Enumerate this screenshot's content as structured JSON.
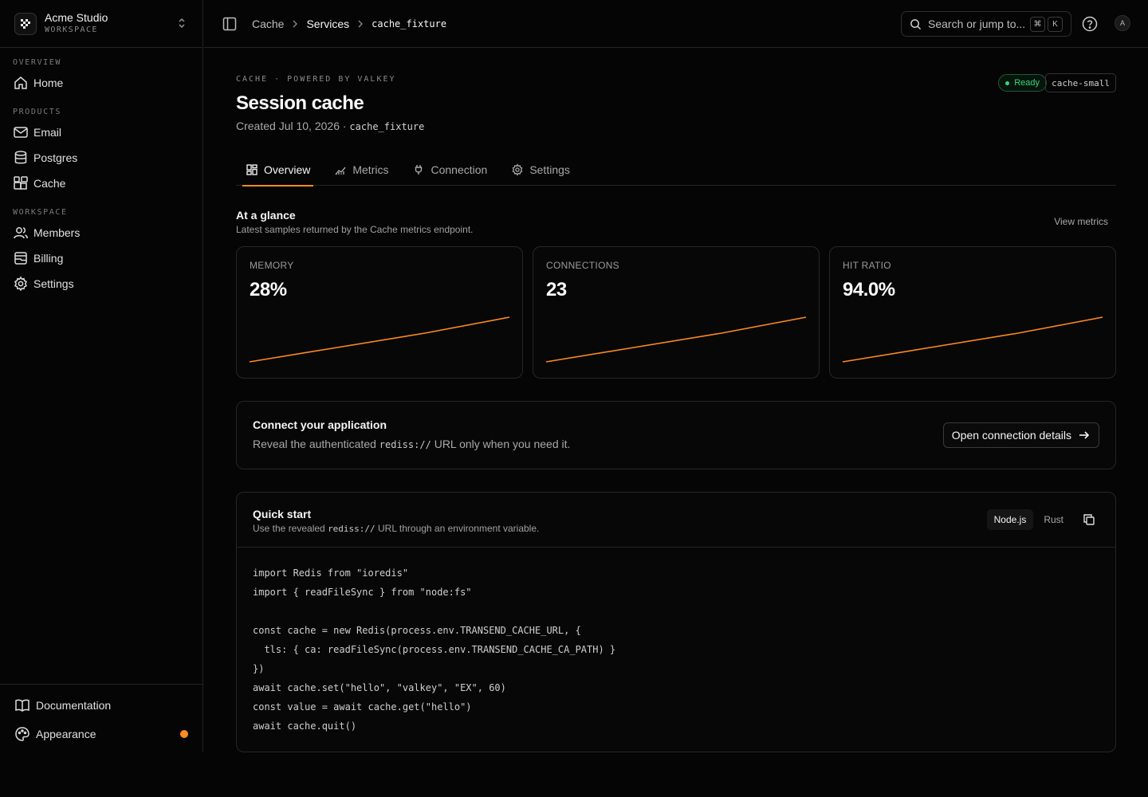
{
  "workspace": {
    "name": "Acme Studio",
    "type": "WORKSPACE"
  },
  "sidebar": {
    "sections": [
      {
        "heading": "OVERVIEW",
        "items": [
          {
            "label": "Home",
            "icon": "home-icon"
          }
        ]
      },
      {
        "heading": "PRODUCTS",
        "items": [
          {
            "label": "Email",
            "icon": "mail-icon"
          },
          {
            "label": "Postgres",
            "icon": "database-icon"
          },
          {
            "label": "Cache",
            "icon": "blocks-icon"
          }
        ]
      },
      {
        "heading": "WORKSPACE",
        "items": [
          {
            "label": "Members",
            "icon": "users-icon"
          },
          {
            "label": "Billing",
            "icon": "billing-icon"
          },
          {
            "label": "Settings",
            "icon": "gear-icon"
          }
        ]
      }
    ],
    "footer": [
      {
        "label": "Documentation",
        "icon": "book-icon"
      },
      {
        "label": "Appearance",
        "icon": "palette-icon"
      }
    ]
  },
  "breadcrumb": {
    "items": [
      "Cache",
      "Services"
    ],
    "current": "cache_fixture"
  },
  "search": {
    "placeholder": "Search or jump to...",
    "shortcut": [
      "⌘",
      "K"
    ]
  },
  "user": {
    "avatar_initial": "A"
  },
  "page": {
    "eyebrow": "CACHE · POWERED BY VALKEY",
    "title": "Session cache",
    "created": "Created Jul 10, 2026 ·",
    "slug": "cache_fixture",
    "status": "Ready",
    "plan": "cache-small"
  },
  "tabs": [
    {
      "label": "Overview",
      "icon": "grid-icon"
    },
    {
      "label": "Metrics",
      "icon": "chart-icon"
    },
    {
      "label": "Connection",
      "icon": "plug-icon"
    },
    {
      "label": "Settings",
      "icon": "gear-icon"
    }
  ],
  "glance": {
    "title": "At a glance",
    "subtitle": "Latest samples returned by the Cache metrics endpoint.",
    "link": "View metrics",
    "cards": [
      {
        "label": "MEMORY",
        "value": "28%"
      },
      {
        "label": "CONNECTIONS",
        "value": "23"
      },
      {
        "label": "HIT RATIO",
        "value": "94.0%"
      }
    ]
  },
  "connect": {
    "title": "Connect your application",
    "text_before": "Reveal the authenticated ",
    "code": "rediss://",
    "text_after": " URL only when you need it.",
    "button": "Open connection details"
  },
  "quickstart": {
    "title": "Quick start",
    "text_before": "Use the revealed ",
    "code": "rediss://",
    "text_after": " URL through an environment variable.",
    "languages": [
      "Node.js",
      "Rust"
    ],
    "snippet": "import Redis from \"ioredis\"\nimport { readFileSync } from \"node:fs\"\n\nconst cache = new Redis(process.env.TRANSEND_CACHE_URL, {\n  tls: { ca: readFileSync(process.env.TRANSEND_CACHE_CA_PATH) }\n})\nawait cache.set(\"hello\", \"valkey\", \"EX\", 60)\nconst value = await cache.get(\"hello\")\nawait cache.quit()"
  },
  "colors": {
    "accent": "#ff8a1f",
    "success": "#37d67a",
    "background": "#050505",
    "border": "#262626"
  }
}
